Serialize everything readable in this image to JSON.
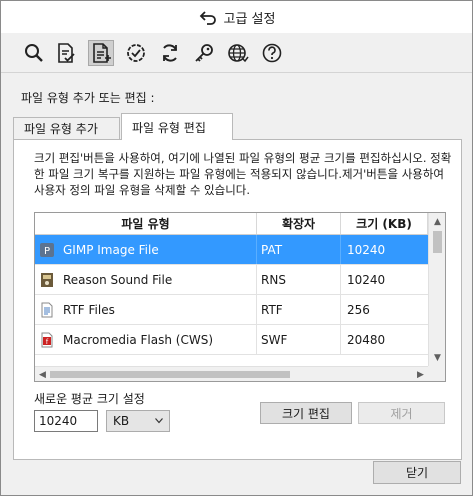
{
  "window": {
    "title": "고급 설정"
  },
  "toolbar": {
    "icons": [
      "search-icon",
      "document-check-icon",
      "document-edit-icon",
      "badge-check-icon",
      "refresh-icon",
      "key-icon",
      "globe-icon",
      "help-icon"
    ],
    "active": "document-edit-icon"
  },
  "section": {
    "title": "파일 유형 추가 또는 편집 :"
  },
  "tabs": [
    {
      "label": "파일 유형 추가",
      "active": false
    },
    {
      "label": "파일 유형 편집",
      "active": true
    }
  ],
  "description": "크기 편집'버튼을 사용하여, 여기에 나열된 파일 유형의 평균 크기를 편집하십시오. 정확한 파일 크기 복구를 지원하는 파일 유형에는 적용되지 않습니다.제거'버튼을 사용하여 사용자 정의 파일 유형을 삭제할 수 있습니다.",
  "table": {
    "columns": [
      "파일 유형",
      "확장자",
      "크기 (KB)"
    ],
    "rows": [
      {
        "name": "GIMP Image File",
        "ext": "PAT",
        "size": "10240",
        "icon": "gimp-icon",
        "selected": true
      },
      {
        "name": "Reason Sound File",
        "ext": "RNS",
        "size": "10240",
        "icon": "sound-file-icon",
        "selected": false
      },
      {
        "name": "RTF Files",
        "ext": "RTF",
        "size": "256",
        "icon": "rtf-file-icon",
        "selected": false
      },
      {
        "name": "Macromedia Flash (CWS)",
        "ext": "SWF",
        "size": "20480",
        "icon": "flash-file-icon",
        "selected": false
      }
    ]
  },
  "avg_size": {
    "label": "새로운 평균 크기 설정",
    "value": "10240",
    "unit": "KB"
  },
  "buttons": {
    "edit_size": "크기 편집",
    "remove": "제거",
    "close": "닫기"
  },
  "colors": {
    "selection": "#3399ff"
  }
}
